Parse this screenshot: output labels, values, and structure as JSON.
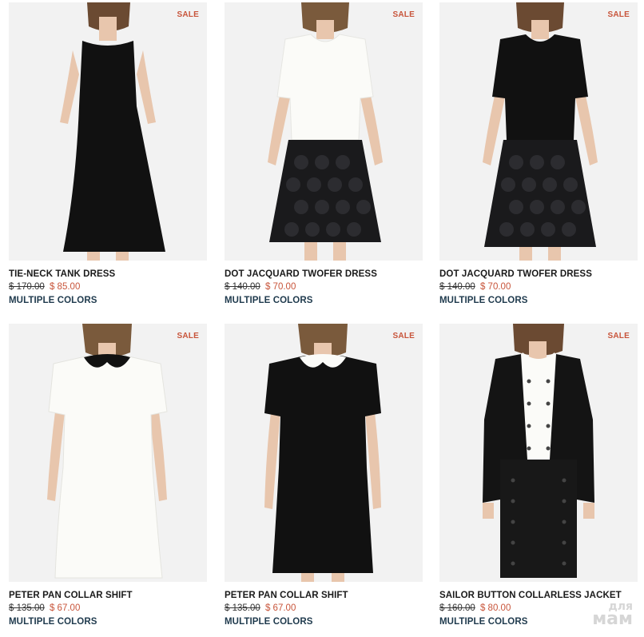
{
  "sale_badge": "SALE",
  "watermark": {
    "line1": "для",
    "line2": "мам"
  },
  "products": [
    {
      "title": "TIE-NECK TANK DRESS",
      "old_price": "$ 170.00",
      "new_price": "$ 85.00",
      "colors": "MULTIPLE COLORS"
    },
    {
      "title": "DOT JACQUARD TWOFER DRESS",
      "old_price": "$ 140.00",
      "new_price": "$ 70.00",
      "colors": "MULTIPLE COLORS"
    },
    {
      "title": "DOT JACQUARD TWOFER DRESS",
      "old_price": "$ 140.00",
      "new_price": "$ 70.00",
      "colors": "MULTIPLE COLORS"
    },
    {
      "title": "PETER PAN COLLAR SHIFT",
      "old_price": "$ 135.00",
      "new_price": "$ 67.00",
      "colors": "MULTIPLE COLORS"
    },
    {
      "title": "PETER PAN COLLAR SHIFT",
      "old_price": "$ 135.00",
      "new_price": "$ 67.00",
      "colors": "MULTIPLE COLORS"
    },
    {
      "title": "SAILOR BUTTON COLLARLESS JACKET",
      "old_price": "$ 160.00",
      "new_price": "$ 80.00",
      "colors": "MULTIPLE COLORS"
    }
  ],
  "colors": {
    "sale": "#c8553b",
    "link": "#1f3a4d",
    "photo_bg": "#f2f2f2"
  }
}
